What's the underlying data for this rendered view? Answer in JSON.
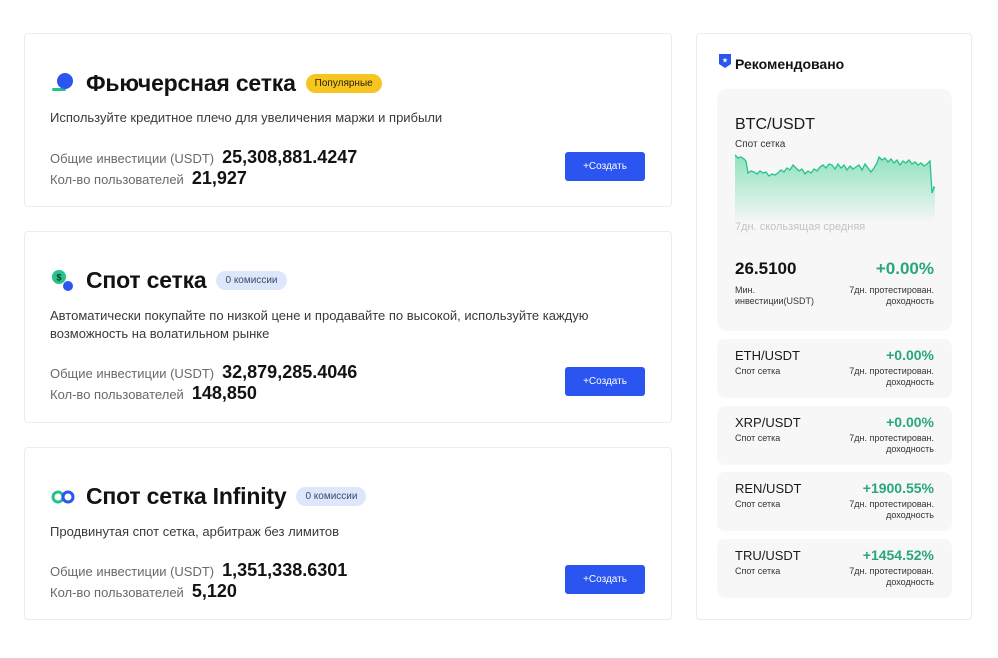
{
  "bots": [
    {
      "icon": "futures-grid-icon",
      "title": "Фьючерсная сетка",
      "badge": "Популярные",
      "description": "Используйте кредитное плечо для увеличения маржи и прибыли",
      "investment_label": "Общие инвестиции (USDT)",
      "investment_value": "25,308,881.4247",
      "users_label": "Кол-во пользователей",
      "users_value": "21,927",
      "button": "+Создать"
    },
    {
      "icon": "spot-grid-icon",
      "title": "Спот сетка",
      "badge": "0 комиссии",
      "description": "Автоматически покупайте по низкой цене и продавайте по высокой, используйте каждую возможность на волатильном рынке",
      "investment_label": "Общие инвестиции (USDT)",
      "investment_value": "32,879,285.4046",
      "users_label": "Кол-во пользователей",
      "users_value": "148,850",
      "button": "+Создать"
    },
    {
      "icon": "infinity-grid-icon",
      "title": "Спот сетка Infinity",
      "badge": "0 комиссии",
      "description": "Продвинутая спот сетка, арбитраж без лимитов",
      "investment_label": "Общие инвестиции (USDT)",
      "investment_value": "1,351,338.6301",
      "users_label": "Кол-во пользователей",
      "users_value": "5,120",
      "button": "+Создать"
    }
  ],
  "recommended": {
    "title": "Рекомендовано",
    "featured": {
      "pair": "BTC/USDT",
      "type": "Спот сетка",
      "ma_label": "7дн. скользящая средняя",
      "min_value": "26.5100",
      "min_label": "Мин. инвестиции(USDT)",
      "pct": "+0.00%",
      "pct_label": "7дн. протестирован. доходность"
    },
    "items": [
      {
        "pair": "ETH/USDT",
        "type": "Спот сетка",
        "pct": "+0.00%",
        "pct_label": "7дн. протестирован. доходность"
      },
      {
        "pair": "XRP/USDT",
        "type": "Спот сетка",
        "pct": "+0.00%",
        "pct_label": "7дн. протестирован. доходность"
      },
      {
        "pair": "REN/USDT",
        "type": "Спот сетка",
        "pct": "+1900.55%",
        "pct_label": "7дн. протестирован. доходность"
      },
      {
        "pair": "TRU/USDT",
        "type": "Спот сетка",
        "pct": "+1454.52%",
        "pct_label": "7дн. протестирован. доходность"
      }
    ]
  },
  "colors": {
    "accent": "#2a55f0",
    "positive": "#28a77c",
    "badge_popular": "#f7c520",
    "badge_fee": "#dde7fb"
  }
}
